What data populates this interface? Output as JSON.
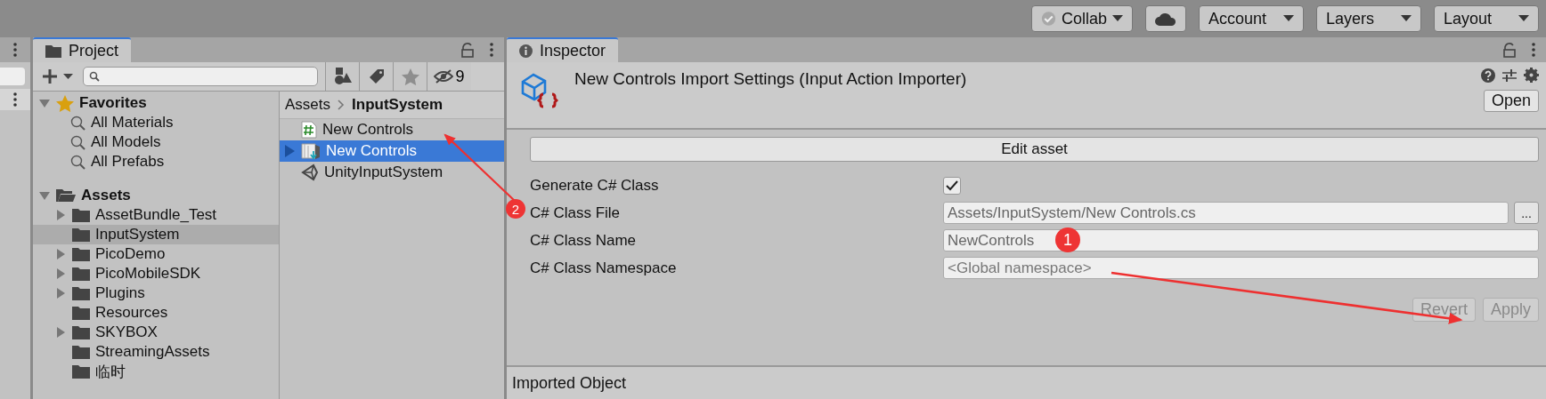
{
  "toolbar": [
    {
      "kind": "status-dropdown",
      "label": "Collab"
    },
    {
      "kind": "icon"
    },
    {
      "kind": "dropdown",
      "label": "Account"
    },
    {
      "kind": "dropdown",
      "label": "Layers"
    },
    {
      "kind": "dropdown",
      "label": "Layout"
    }
  ],
  "project": {
    "tab": {
      "label": "Project",
      "selected": true
    },
    "hidden_count": "9",
    "tree": [
      {
        "label": "Favorites",
        "kind": "favorites",
        "expanded": true,
        "children": [
          {
            "label": "All Materials"
          },
          {
            "label": "All Models"
          },
          {
            "label": "All Prefabs"
          }
        ]
      },
      {
        "label": "Assets",
        "kind": "root",
        "expanded": true,
        "children": [
          {
            "label": "AssetBundle_Test",
            "expandable": true,
            "selected": false
          },
          {
            "label": "InputSystem",
            "expandable": false,
            "selected": true
          },
          {
            "label": "PicoDemo",
            "expandable": true,
            "selected": false
          },
          {
            "label": "PicoMobileSDK",
            "expandable": true,
            "selected": false
          },
          {
            "label": "Plugins",
            "expandable": true,
            "selected": false
          },
          {
            "label": "Resources",
            "expandable": false,
            "selected": false
          },
          {
            "label": "SKYBOX",
            "expandable": true,
            "selected": false
          },
          {
            "label": "StreamingAssets",
            "expandable": false,
            "selected": false
          },
          {
            "label": "临时",
            "expandable": false,
            "selected": false
          }
        ]
      }
    ],
    "breadcrumb": [
      "Assets",
      "InputSystem"
    ],
    "files": [
      {
        "label": "New Controls",
        "kind": "script",
        "expandable": false,
        "selected": false
      },
      {
        "label": "New Controls",
        "kind": "input-actions",
        "expandable": true,
        "selected": true
      },
      {
        "label": "UnityInputSystem",
        "kind": "unity",
        "expandable": false,
        "selected": false
      }
    ]
  },
  "inspector": {
    "tab": {
      "label": "Inspector",
      "selected": true
    },
    "title": "New Controls Import Settings (Input Action Importer)",
    "open_button": "Open",
    "edit_button": "Edit asset",
    "fields": [
      {
        "kind": "checkbox",
        "label": "Generate C# Class",
        "checked": true
      },
      {
        "kind": "text",
        "label": "C# Class File",
        "value": "Assets/InputSystem/New Controls.cs",
        "browse_button": "..."
      },
      {
        "kind": "text",
        "label": "C# Class Name",
        "value": "NewControls"
      },
      {
        "kind": "text",
        "label": "C# Class Namespace",
        "placeholder": "<Global namespace>"
      }
    ],
    "actions": [
      {
        "label": "Revert",
        "disabled": true
      },
      {
        "label": "Apply",
        "disabled": true
      }
    ],
    "footer": "Imported Object"
  },
  "annotations": [
    {
      "label": "2"
    },
    {
      "label": "1"
    }
  ]
}
